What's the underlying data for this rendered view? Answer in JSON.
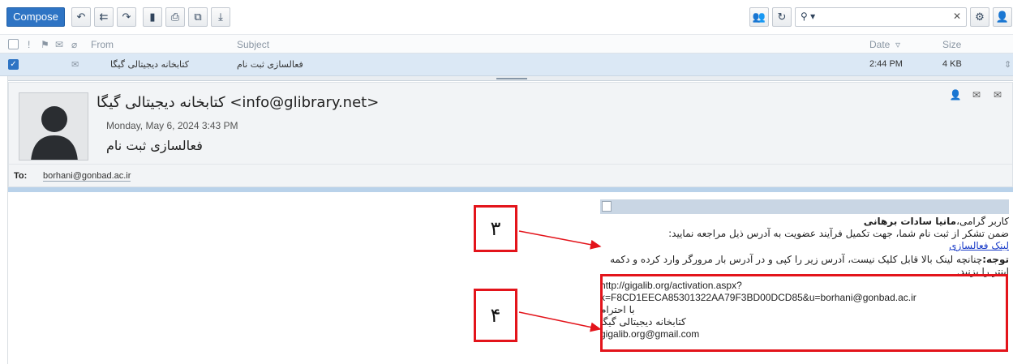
{
  "toolbar": {
    "compose_label": "Compose",
    "search_placeholder": "",
    "icons": [
      "reply-icon",
      "reply-all-icon",
      "forward-icon",
      "delete-icon",
      "print-icon",
      "attachment-icon",
      "download-icon"
    ]
  },
  "list": {
    "headers": {
      "from": "From",
      "subject": "Subject",
      "date": "Date",
      "size": "Size"
    },
    "row": {
      "from": "کتابخانه دیجیتالی گیگا",
      "subject": "فعالسازی ثبت نام",
      "date": "2:44 PM",
      "size": "4 KB"
    }
  },
  "message": {
    "sender": "کتابخانه دیجیتالی گیگا <info@glibrary.net>",
    "date": "Monday, May 6, 2024 3:43 PM",
    "subject": "فعالسازی ثبت نام",
    "to_label": "To:",
    "to_value": "borhani@gonbad.ac.ir"
  },
  "body": {
    "greeting_prefix": "کاربر گرامی،",
    "greeting_name": "مانیا سادات برهانی",
    "line1": "ضمن تشکر از ثبت نام شما، جهت تکمیل فرآیند عضویت به آدرس ذیل مراجعه نمایید:",
    "link_text": "لینک فعالسازی",
    "note_label": "توجه:",
    "note_text": "چنانچه لینک بالا قابل کلیک نیست، آدرس زیر را کپی و در آدرس بار مرورگر وارد کرده و دکمه اینتر را بزنید.",
    "url_line1": "http://gigalib.org/activation.aspx?",
    "url_line2": "k=F8CD1EECA85301322AA79F3BD00DCD85&u=borhani@gonbad.ac.ir",
    "regards": "با احترام",
    "org": "کتابخانه دیجیتالی گیگا",
    "email": "gigalib.org@gmail.com"
  },
  "annotations": {
    "label3": "۳",
    "label4": "۴"
  },
  "colors": {
    "accent": "#2e74c4",
    "annotation_red": "#e3141b",
    "selected_row": "#dbe8f5"
  }
}
